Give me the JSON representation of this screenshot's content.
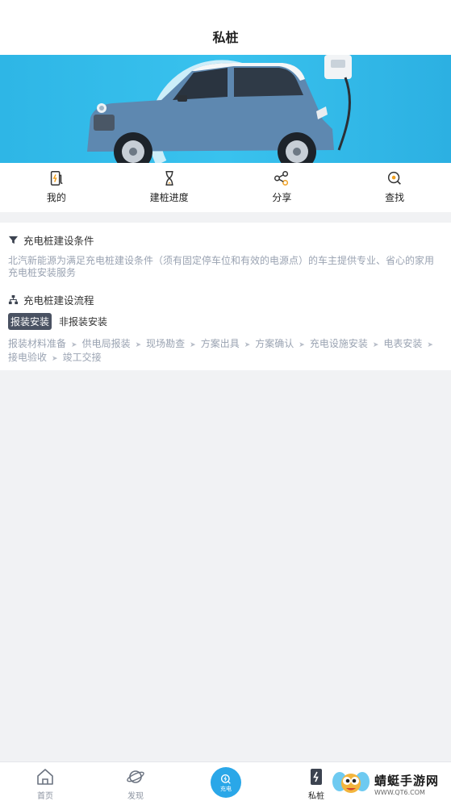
{
  "header": {
    "title": "私桩"
  },
  "quicknav": [
    {
      "icon": "charger-icon",
      "label": "我的"
    },
    {
      "icon": "hourglass-icon",
      "label": "建桩进度"
    },
    {
      "icon": "share-icon",
      "label": "分享"
    },
    {
      "icon": "search-icon",
      "label": "查找"
    }
  ],
  "conditions": {
    "title": "充电桩建设条件",
    "description": "北汽新能源为满足充电桩建设条件（须有固定停车位和有效的电源点）的车主提供专业、省心的家用充电桩安装服务"
  },
  "process": {
    "title": "充电桩建设流程",
    "tabs": [
      {
        "label": "报装安装",
        "active": true
      },
      {
        "label": "非报装安装",
        "active": false
      }
    ],
    "steps": [
      "报装材料准备",
      "供电局报装",
      "现场勘查",
      "方案出具",
      "方案确认",
      "充电设施安装",
      "电表安装",
      "接电验收",
      "竣工交接"
    ]
  },
  "tabbar": [
    {
      "icon": "home-icon",
      "label": "首页"
    },
    {
      "icon": "planet-icon",
      "label": "发现"
    },
    {
      "icon": "charge-icon",
      "label": "充电"
    },
    {
      "icon": "private-pile-icon",
      "label": "私桩"
    }
  ],
  "watermark": {
    "name": "蜻蜓手游网",
    "url": "WWW.QT6.COM"
  },
  "colors": {
    "accent": "#2aa7e8",
    "tab_active_bg": "#4a5262",
    "muted_text": "#9aa3b2"
  }
}
